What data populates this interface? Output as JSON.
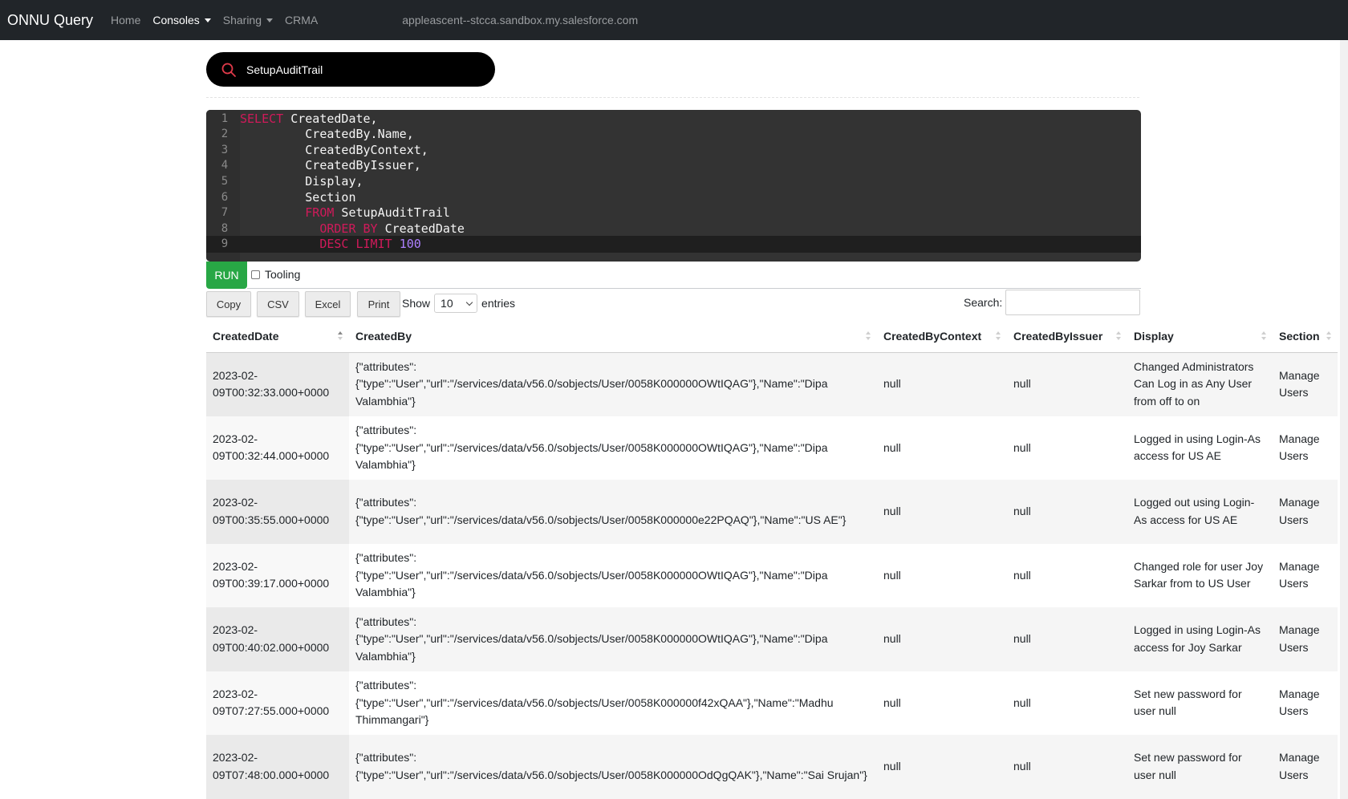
{
  "navbar": {
    "brand": "ONNU Query",
    "links": [
      {
        "label": "Home",
        "dropdown": false,
        "active": false
      },
      {
        "label": "Consoles",
        "dropdown": true,
        "active": true
      },
      {
        "label": "Sharing",
        "dropdown": true,
        "active": false
      },
      {
        "label": "CRMA",
        "dropdown": false,
        "active": false
      }
    ],
    "host": "appleascent--stcca.sandbox.my.salesforce.com"
  },
  "object_search": {
    "value": "SetupAuditTrail",
    "icon": "search-icon",
    "icon_color": "#e03a4a"
  },
  "editor": {
    "lines": [
      [
        {
          "t": "SELECT",
          "k": "kw"
        },
        {
          "t": " CreatedDate,",
          "k": "code"
        }
      ],
      [
        {
          "t": "         CreatedBy.Name,",
          "k": "code"
        }
      ],
      [
        {
          "t": "         CreatedByContext,",
          "k": "code"
        }
      ],
      [
        {
          "t": "         CreatedByIssuer,",
          "k": "code"
        }
      ],
      [
        {
          "t": "         Display,",
          "k": "code"
        }
      ],
      [
        {
          "t": "         Section",
          "k": "code"
        }
      ],
      [
        {
          "t": "         ",
          "k": "code"
        },
        {
          "t": "FROM",
          "k": "kw"
        },
        {
          "t": " SetupAuditTrail",
          "k": "code"
        }
      ],
      [
        {
          "t": "           ",
          "k": "code"
        },
        {
          "t": "ORDER BY",
          "k": "kw"
        },
        {
          "t": " CreatedDate",
          "k": "code"
        }
      ],
      [
        {
          "t": "           ",
          "k": "code"
        },
        {
          "t": "DESC LIMIT",
          "k": "kw"
        },
        {
          "t": " ",
          "k": "code"
        },
        {
          "t": "100",
          "k": "num"
        }
      ]
    ]
  },
  "controls": {
    "run_label": "RUN",
    "tooling_label": "Tooling",
    "tooling_checked": false,
    "buttons": [
      "Copy",
      "CSV",
      "Excel",
      "Print"
    ],
    "show_label": "Show",
    "entries_value": "10",
    "entries_label": "entries",
    "search_label": "Search:",
    "search_value": ""
  },
  "table": {
    "columns": [
      "CreatedDate",
      "CreatedBy",
      "CreatedByContext",
      "CreatedByIssuer",
      "Display",
      "Section"
    ],
    "rows": [
      [
        "2023-02-09T00:32:33.000+0000",
        "{\"attributes\": {\"type\":\"User\",\"url\":\"/services/data/v56.0/sobjects/User/0058K000000OWtIQAG\"},\"Name\":\"Dipa Valambhia\"}",
        "null",
        "null",
        "Changed Administrators Can Log in as Any User from off to on",
        "Manage Users"
      ],
      [
        "2023-02-09T00:32:44.000+0000",
        "{\"attributes\": {\"type\":\"User\",\"url\":\"/services/data/v56.0/sobjects/User/0058K000000OWtIQAG\"},\"Name\":\"Dipa Valambhia\"}",
        "null",
        "null",
        "Logged in using Login-As access for US AE",
        "Manage Users"
      ],
      [
        "2023-02-09T00:35:55.000+0000",
        "{\"attributes\": {\"type\":\"User\",\"url\":\"/services/data/v56.0/sobjects/User/0058K000000e22PQAQ\"},\"Name\":\"US AE\"}",
        "null",
        "null",
        "Logged out using Login-As access for US AE",
        "Manage Users"
      ],
      [
        "2023-02-09T00:39:17.000+0000",
        "{\"attributes\": {\"type\":\"User\",\"url\":\"/services/data/v56.0/sobjects/User/0058K000000OWtIQAG\"},\"Name\":\"Dipa Valambhia\"}",
        "null",
        "null",
        "Changed role for user Joy Sarkar from to US User",
        "Manage Users"
      ],
      [
        "2023-02-09T00:40:02.000+0000",
        "{\"attributes\": {\"type\":\"User\",\"url\":\"/services/data/v56.0/sobjects/User/0058K000000OWtIQAG\"},\"Name\":\"Dipa Valambhia\"}",
        "null",
        "null",
        "Logged in using Login-As access for Joy Sarkar",
        "Manage Users"
      ],
      [
        "2023-02-09T07:27:55.000+0000",
        "{\"attributes\": {\"type\":\"User\",\"url\":\"/services/data/v56.0/sobjects/User/0058K000000f42xQAA\"},\"Name\":\"Madhu Thimmangari\"}",
        "null",
        "null",
        "Set new password for user null",
        "Manage Users"
      ],
      [
        "2023-02-09T07:48:00.000+0000",
        "{\"attributes\": {\"type\":\"User\",\"url\":\"/services/data/v56.0/sobjects/User/0058K000000OdQgQAK\"},\"Name\":\"Sai Srujan\"}",
        "null",
        "null",
        "Set new password for user null",
        "Manage Users"
      ]
    ]
  },
  "colors": {
    "navbar_bg": "#212529",
    "run_green": "#28a745",
    "editor_bg": "#333333",
    "keyword": "#d01a5a",
    "number": "#ae81ff"
  }
}
